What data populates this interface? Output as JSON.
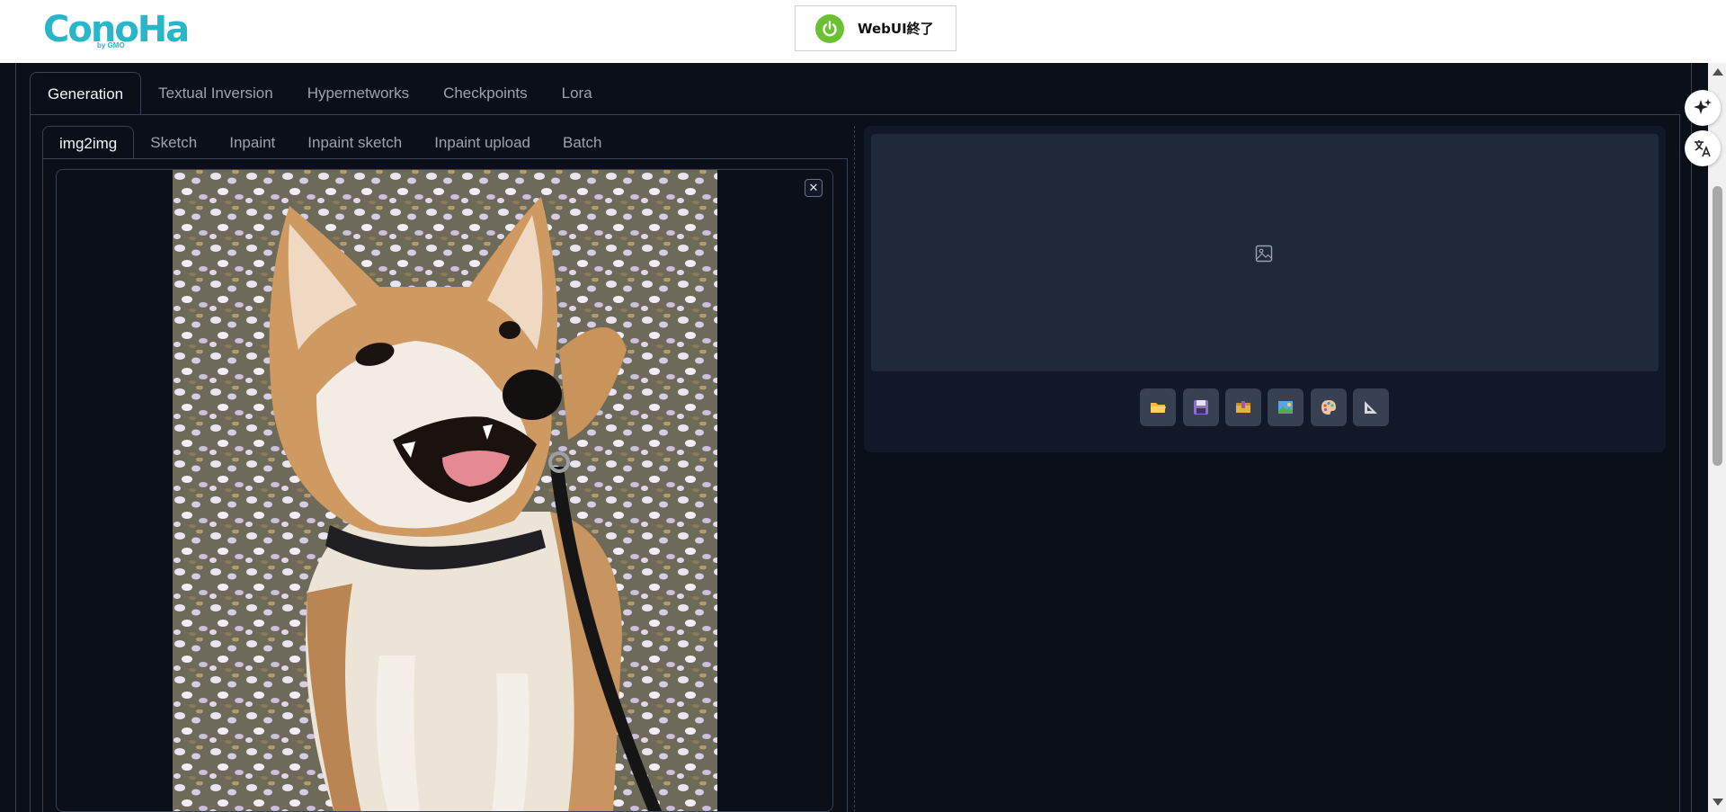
{
  "header": {
    "logo_text": "ConoHa",
    "logo_sub": "by GMO",
    "stop_button_label": "WebUI終了"
  },
  "main_tabs": [
    {
      "label": "Generation",
      "active": true
    },
    {
      "label": "Textual Inversion",
      "active": false
    },
    {
      "label": "Hypernetworks",
      "active": false
    },
    {
      "label": "Checkpoints",
      "active": false
    },
    {
      "label": "Lora",
      "active": false
    }
  ],
  "sub_tabs": [
    {
      "label": "img2img",
      "active": true
    },
    {
      "label": "Sketch",
      "active": false
    },
    {
      "label": "Inpaint",
      "active": false
    },
    {
      "label": "Inpaint sketch",
      "active": false
    },
    {
      "label": "Inpaint upload",
      "active": false
    },
    {
      "label": "Batch",
      "active": false
    }
  ],
  "input_image": {
    "close_glyph": "✕",
    "subject": "shiba-inu-dog-photo"
  },
  "output_toolbar": {
    "buttons": [
      "open-folder-icon",
      "save-icon",
      "zip-icon",
      "send-to-img2img-icon",
      "send-to-inpaint-icon",
      "send-to-extras-icon"
    ]
  },
  "colors": {
    "background": "#0b0f19",
    "border": "#374151",
    "panel": "#111827",
    "gallery": "#1f2937",
    "logo": "#29b6c8",
    "power": "#6cc033"
  }
}
